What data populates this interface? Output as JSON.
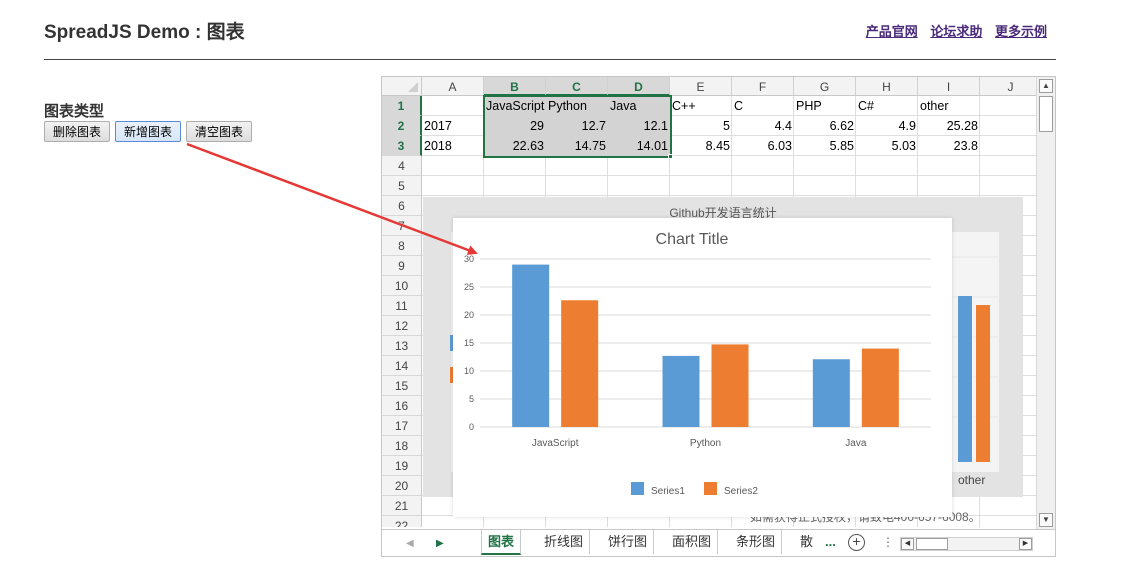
{
  "page": {
    "title": "SpreadJS Demo : 图表",
    "links": [
      "产品官网",
      "论坛求助",
      "更多示例"
    ],
    "chart_type_label": "图表类型",
    "buttons": {
      "delete": "删除图表",
      "add": "新增图表",
      "clear": "清空图表"
    }
  },
  "sheet": {
    "columns": [
      "A",
      "B",
      "C",
      "D",
      "E",
      "F",
      "G",
      "H",
      "I",
      "J"
    ],
    "rows": [
      "1",
      "2",
      "3",
      "4",
      "5",
      "6",
      "7",
      "8",
      "9",
      "10",
      "11",
      "12",
      "13",
      "14",
      "15",
      "16",
      "17",
      "18",
      "19",
      "20",
      "21",
      "22"
    ],
    "cells": [
      [
        "",
        "JavaScript",
        "Python",
        "Java",
        "C++",
        "C",
        "PHP",
        "C#",
        "other"
      ],
      [
        "2017",
        "29",
        "12.7",
        "12.1",
        "5",
        "4.4",
        "6.62",
        "4.9",
        "25.28"
      ],
      [
        "2018",
        "22.63",
        "14.75",
        "14.01",
        "8.45",
        "6.03",
        "5.85",
        "5.03",
        "23.8"
      ]
    ],
    "background_chart": {
      "title": "Github开发语言统计",
      "last_category": "other"
    },
    "footer_text": "如需获得正式授权，请致电400-657-6008。",
    "tabs": [
      "图表",
      "折线图",
      "饼行图",
      "面积图",
      "条形图",
      "散"
    ],
    "tab_more": "...",
    "tab_dots": "⋮",
    "tab_add": "+"
  },
  "colors": {
    "series1": "#5b9bd5",
    "series2": "#ed7d31",
    "accent": "#217346",
    "arrow": "#e53935"
  },
  "chart_data": {
    "type": "bar",
    "title": "Chart Title",
    "categories": [
      "JavaScript",
      "Python",
      "Java"
    ],
    "series": [
      {
        "name": "Series1",
        "values": [
          29,
          12.7,
          12.1
        ]
      },
      {
        "name": "Series2",
        "values": [
          22.63,
          14.75,
          14.01
        ]
      }
    ],
    "ylim": [
      0,
      30
    ],
    "yticks": [
      "0",
      "5",
      "10",
      "15",
      "20",
      "25",
      "30"
    ],
    "grid": true,
    "legend": "bottom"
  }
}
